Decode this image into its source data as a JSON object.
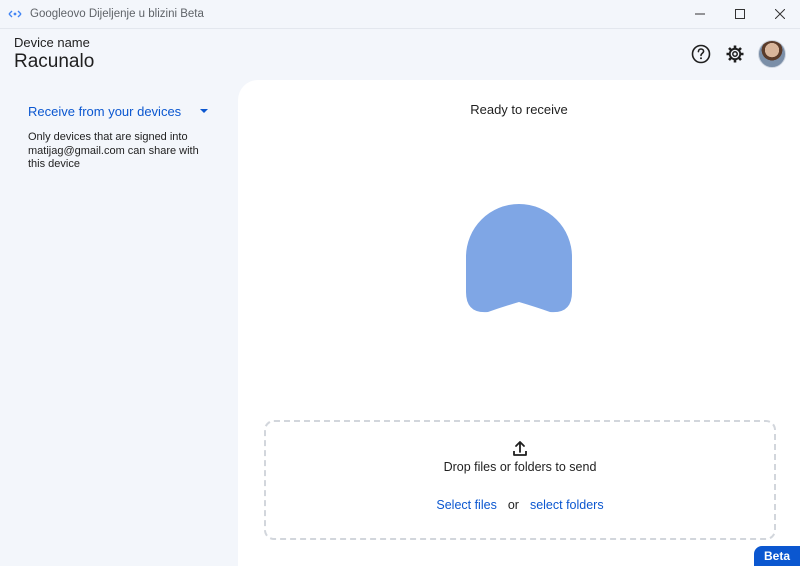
{
  "window": {
    "title": "Googleovo Dijeljenje u blizini Beta",
    "icons": {
      "app": "nearby-share-icon",
      "minimize": "minimize-icon",
      "maximize": "maximize-icon",
      "close": "close-icon"
    }
  },
  "header": {
    "device_label": "Device name",
    "device_name": "Racunalo",
    "icons": [
      "help-icon",
      "settings-icon",
      "avatar"
    ]
  },
  "sidebar": {
    "receive_option": "Receive from your devices",
    "visibility_note": "Only devices that are signed into matijag@gmail.com can share with this device"
  },
  "main": {
    "status": "Ready to receive",
    "blob_color": "#7fa6e5",
    "dropzone": {
      "text": "Drop files or folders to send",
      "select_files": "Select files",
      "or": "or",
      "select_folders": "select folders"
    }
  },
  "badge": "Beta",
  "colors": {
    "accent": "#0b57d0",
    "background": "#f3f6fb",
    "panel": "#ffffff"
  }
}
